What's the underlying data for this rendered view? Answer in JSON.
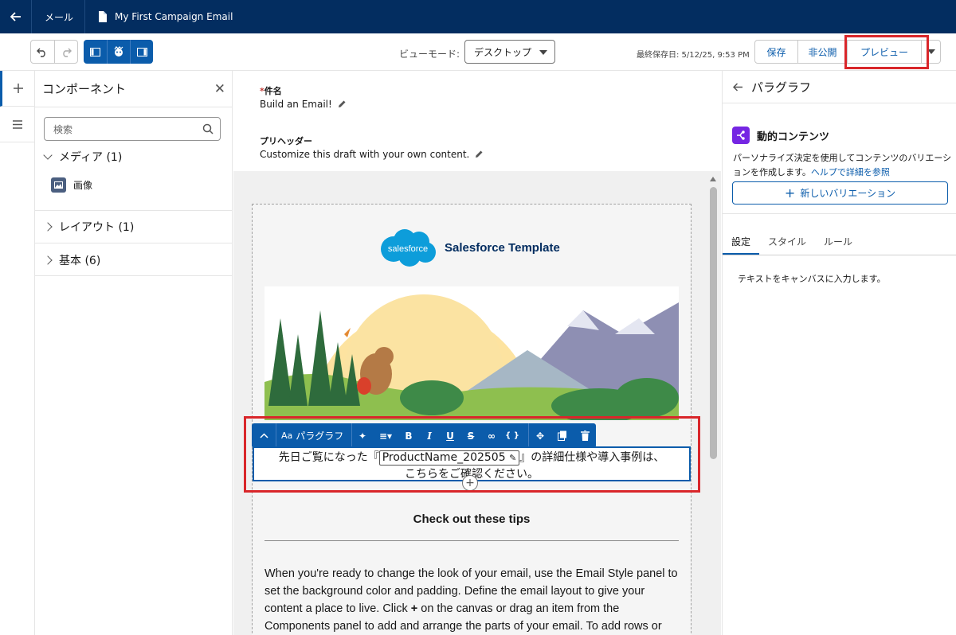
{
  "nav": {
    "back": "←",
    "mail_tab": "メール",
    "doc_title": "My First Campaign Email"
  },
  "toolbar": {
    "viewmode_label": "ビューモード:",
    "viewmode_value": "デスクトップ",
    "last_saved": "最終保存日: 5/12/25, 9:53 PM",
    "save": "保存",
    "unpublish": "非公開",
    "preview": "プレビュー"
  },
  "components": {
    "title": "コンポーネント",
    "search_placeholder": "検索",
    "sections": [
      {
        "label": "メディア (1)",
        "expanded": true
      },
      {
        "label": "レイアウト (1)",
        "expanded": false
      },
      {
        "label": "基本 (6)",
        "expanded": false
      }
    ],
    "media_item": "画像"
  },
  "canvas": {
    "subject_label": "件名",
    "subject_required": "*",
    "subject_value": "Build an Email!",
    "preheader_label": "プリヘッダー",
    "preheader_value": "Customize this draft with your own content.",
    "logo_word": "salesforce",
    "template_title": "Salesforce Template",
    "format_bar": {
      "block_type": "パラグラフ",
      "block_type_icon": "Aa"
    },
    "paragraph_before": "先日ご覧になった『",
    "merge_field": "ProductName_202505",
    "paragraph_after": "』の詳細仕様や導入事例は、",
    "paragraph_line2": "こちらをご確認ください。",
    "tips_title": "Check out these tips",
    "tips_body_1": "When you're ready to change the look of your email, use the Email Style panel to set the background color and padding. Define the email layout to give your content a place to live. Click ",
    "tips_plus": "+",
    "tips_body_2": " on the canvas or drag an item from the Components panel to add and arrange the parts of your email. To add rows or"
  },
  "panel": {
    "title": "パラグラフ",
    "dynamic_title": "動的コンテンツ",
    "dynamic_desc": "パーソナライズ決定を使用してコンテンツのバリエーションを作成します。",
    "help_link": "ヘルプで詳細を参照",
    "new_variation": "新しいバリエーション",
    "tabs": [
      "設定",
      "スタイル",
      "ルール"
    ],
    "active_tab": "設定",
    "hint": "テキストをキャンバスに入力します。"
  },
  "colors": {
    "nav_bg": "#032d60",
    "brand": "#0b5cab",
    "highlight": "#d9262a",
    "dynamic_icon": "#7526e3"
  }
}
